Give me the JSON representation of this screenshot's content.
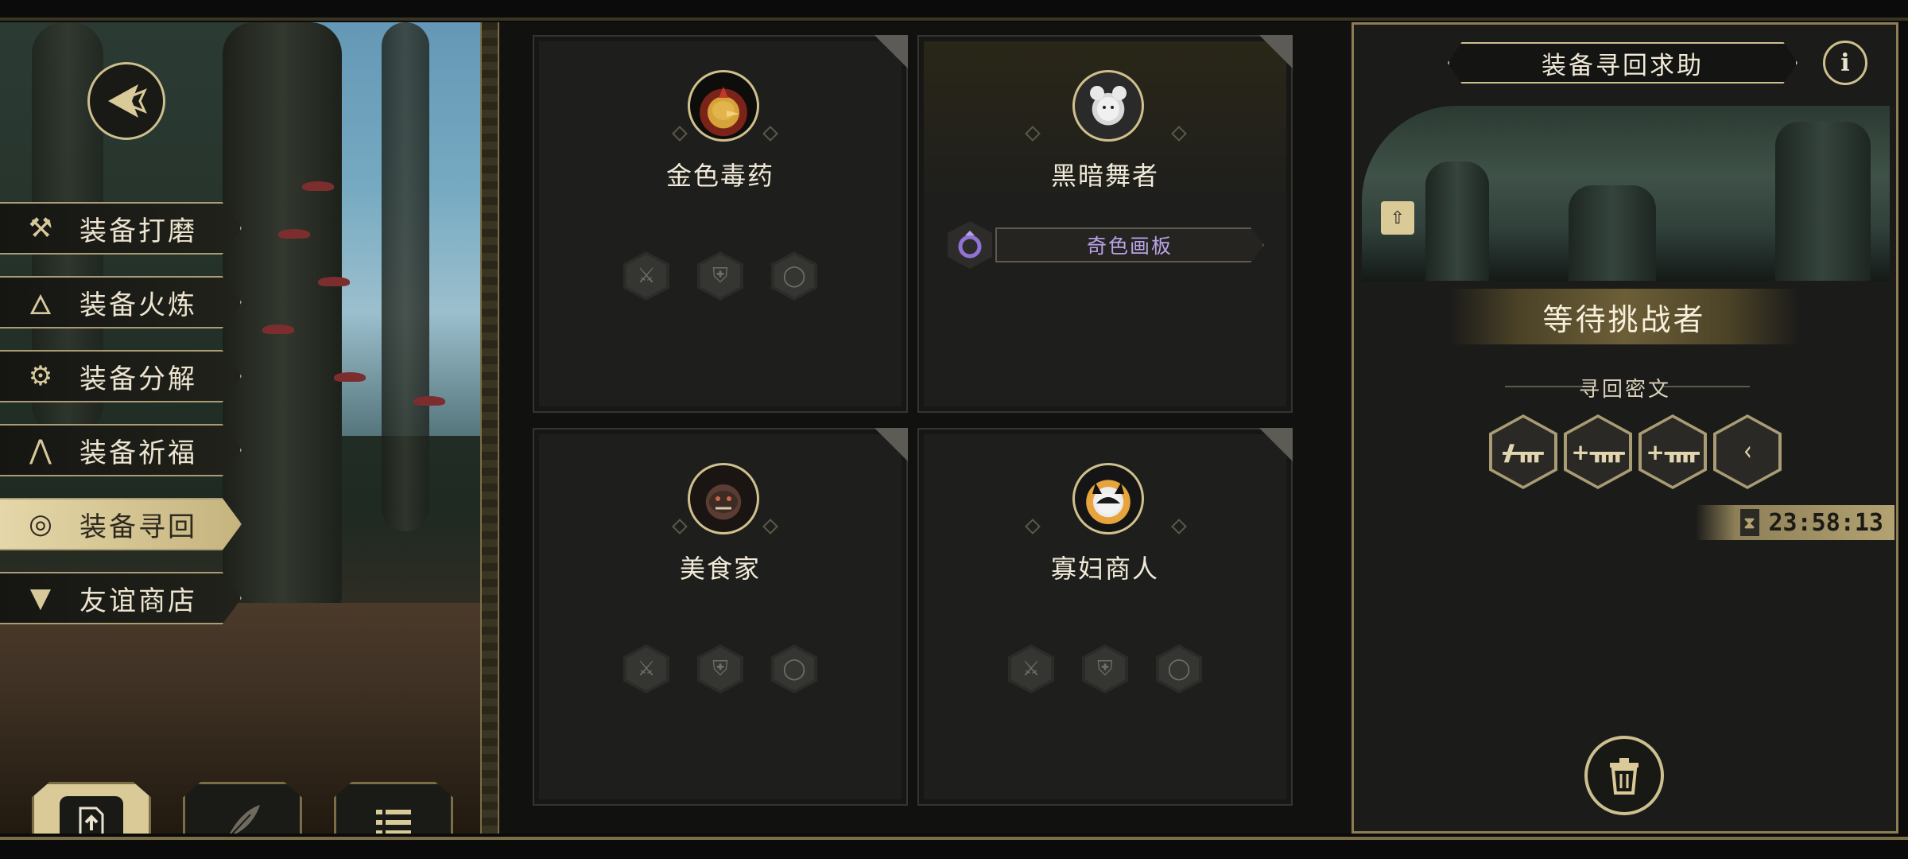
{
  "menu": {
    "items": [
      {
        "label": "装备打磨",
        "icon": "hammer-icon"
      },
      {
        "label": "装备火炼",
        "icon": "flame-icon"
      },
      {
        "label": "装备分解",
        "icon": "disassemble-icon"
      },
      {
        "label": "装备祈福",
        "icon": "pray-hands-icon"
      },
      {
        "label": "装备寻回",
        "icon": "target-icon",
        "active": true
      },
      {
        "label": "友谊商店",
        "icon": "fox-icon"
      }
    ]
  },
  "bottom_tabs": [
    {
      "icon": "upload-icon",
      "active": true
    },
    {
      "icon": "feather-icon",
      "active": false
    },
    {
      "icon": "list-icon",
      "active": false
    }
  ],
  "cards": [
    {
      "name": "金色毒药",
      "portrait": "golden-beak-bird-portrait",
      "slots": [
        "sword-icon",
        "armor-icon",
        "ring-icon"
      ]
    },
    {
      "name": "黑暗舞者",
      "portrait": "white-mouse-portrait",
      "item": {
        "label": "奇色画板",
        "icon": "purple-ring-icon",
        "color": "#b9a3e6"
      }
    },
    {
      "name": "美食家",
      "portrait": "dark-beast-portrait",
      "slots": [
        "sword-icon",
        "armor-icon",
        "ring-icon"
      ]
    },
    {
      "name": "寡妇商人",
      "portrait": "black-white-cat-portrait",
      "slots": [
        "sword-icon",
        "armor-icon",
        "ring-icon"
      ]
    }
  ],
  "right_panel": {
    "title": "装备寻回求助",
    "info_symbol": "i",
    "status": "等待挑战者",
    "cipher_label": "寻回密文",
    "runes": [
      "ᚋᚃ",
      "+ᚄ",
      "+ᚄ",
      "ᚲ"
    ],
    "timer": "23:58:13"
  },
  "colors": {
    "gold_border": "#cdbf8e",
    "panel_bg": "#1b1b19",
    "item_text": "#b9a3e6",
    "active_menu": "#e5d7a9"
  }
}
